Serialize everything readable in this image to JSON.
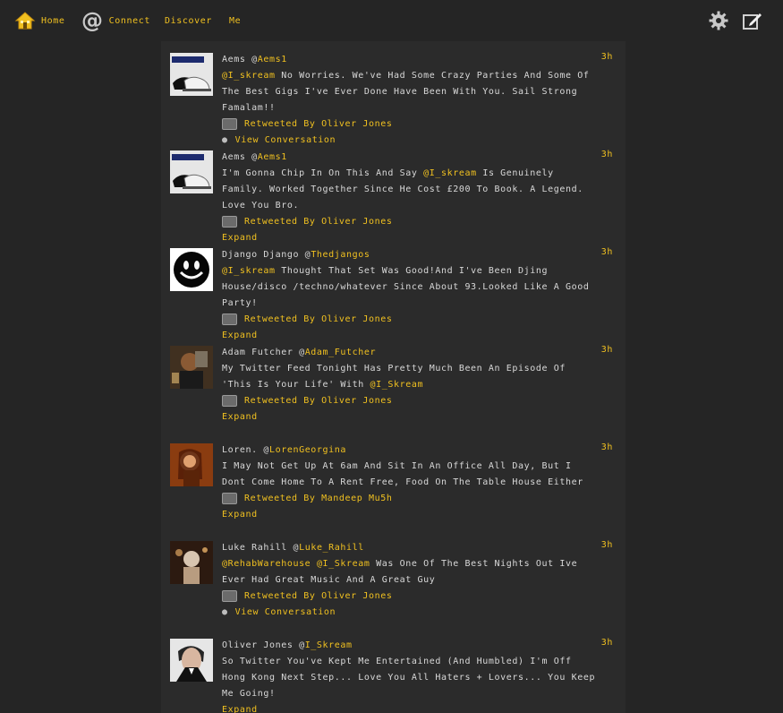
{
  "nav": {
    "home": "Home",
    "connect": "Connect",
    "discover": "Discover",
    "me": "Me",
    "icons": [
      "home-icon",
      "at-icon",
      "gear-icon",
      "compose-icon"
    ]
  },
  "tweets": [
    {
      "name": "Aems @",
      "handle": "Aems1",
      "time": "3h",
      "mention": "@I_skream",
      "text": " No Worries. We've Had Some Crazy Parties And Some Of The Best Gigs I've Ever Done Have Been With You. Sail Strong Famalam!!",
      "retweet": "Retweeted By Oliver Jones",
      "action": "View Conversation"
    },
    {
      "name": "Aems @",
      "handle": "Aems1",
      "time": "3h",
      "text_before": "I'm Gonna Chip In On This And Say ",
      "mention": "@I_skream",
      "text": " Is Genuinely Family. Worked Together Since He Cost £200 To Book. A Legend. Love You Bro.",
      "retweet": "Retweeted By Oliver Jones",
      "action": "Expand"
    },
    {
      "name": "Django Django @",
      "handle": "Thedjangos",
      "time": "3h",
      "mention": "@I_skream",
      "text": " Thought That Set Was Good!And I've Been Djing House/disco /techno/whatever Since About 93.Looked Like A Good Party!",
      "retweet": "Retweeted By Oliver Jones",
      "action": "Expand"
    },
    {
      "name": "Adam Futcher @",
      "handle": "Adam_Futcher",
      "time": "3h",
      "text_before": "My Twitter Feed Tonight Has Pretty Much Been An Episode Of 'This Is Your Life' With ",
      "mention": "@I_Skream",
      "text": "",
      "retweet": "Retweeted By Oliver Jones",
      "action": "Expand"
    },
    {
      "name": "Loren. @",
      "handle": "LorenGeorgina",
      "time": "3h",
      "text": "I May Not Get Up At 6am And Sit In An Office All Day, But I Dont Come Home To A Rent Free, Food On The Table House Either",
      "retweet": "Retweeted By Mandeep Mu5h",
      "action": "Expand"
    },
    {
      "name": "Luke Rahill @",
      "handle": "Luke_Rahill",
      "time": "3h",
      "mention": "@RehabWarehouse",
      "mention2": "@I_Skream",
      "text": " Was One Of The Best Nights Out Ive Ever Had Great Music And A Great Guy",
      "retweet": "Retweeted By Oliver Jones",
      "action": "View Conversation"
    },
    {
      "name": "Oliver Jones @",
      "handle": "I_Skream",
      "time": "3h",
      "text": "So Twitter You've Kept Me Entertained (And Humbled) I'm Off Hong Kong Next Step... Love You All Haters + Lovers... You Keep Me Going!",
      "action": "Expand"
    }
  ]
}
